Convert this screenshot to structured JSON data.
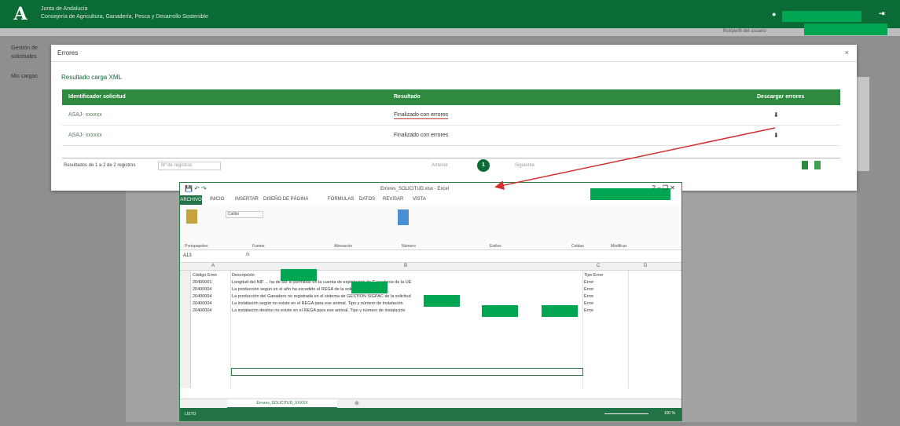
{
  "header": {
    "brand_line1": "Junta de Andalucía",
    "brand_line2": "Consejería de Agricultura, Ganadería, Pesca y Desarrollo Sostenible",
    "logo": "A",
    "user_icon": "user-icon",
    "logout_icon": "logout-icon",
    "logout": "⇥"
  },
  "subheader": {
    "info": "Rol/perfil del usuario"
  },
  "background": {
    "left_item1": "Gestión de solicitudes",
    "left_item2": "Mis cargas"
  },
  "modal": {
    "title": "Errores",
    "close": "×",
    "subtitle": "Resultado carga XML",
    "columns": [
      "Identificador solicitud",
      "Resultado",
      "Descargar errores"
    ],
    "rows": [
      {
        "id": "ASAJ- xxxxxx",
        "result": "Finalizado con errores",
        "download": "⬇"
      },
      {
        "id": "ASAJ- xxxxxx",
        "result": "Finalizado con errores",
        "download": "⬇"
      }
    ],
    "pager": {
      "label": "Resultados de 1 a 2 de 2 registros",
      "select_placeholder": "Nº de registros",
      "prev": "Anterior",
      "page": "1",
      "next": "Siguiente"
    }
  },
  "excel": {
    "filename": "Errores_SOLICITUD.xlsx - Excel",
    "quick_access": "💾 ↶ ↷",
    "window_controls": "?  –  ❐  ✕",
    "tabs": [
      "ARCHIVO",
      "INICIO",
      "INSERTAR",
      "DISEÑO DE PÁGINA",
      "FÓRMULAS",
      "DATOS",
      "REVISAR",
      "VISTA"
    ],
    "ribbon_groups": [
      "Portapapeles",
      "Fuente",
      "Alineación",
      "Número",
      "Estilos",
      "Celdas",
      "Modificar"
    ],
    "font_name": "Calibri",
    "cell_ref": "A13",
    "fx": "fx",
    "columns": [
      "A",
      "B",
      "C",
      "D"
    ],
    "rows": [
      {
        "code": "Código Error",
        "desc": "Descripción",
        "type": "Tipo Error"
      },
      {
        "code": "20400001",
        "desc": "Longitud del NIF ... ha de ser el permitido en la cuenta de explotación de Ganaderos de la UE",
        "type": "Error"
      },
      {
        "code": "20400004",
        "desc": "La producción según en el año ha excedido el REGA de la solicitud",
        "type": "Error"
      },
      {
        "code": "20400004",
        "desc": "La producción del Ganadero no registrada en el sistema de GESTIÓN SIGPAC de la solicitud",
        "type": "Error"
      },
      {
        "code": "20400004",
        "desc": "La instalación según no existe en el REGA para ese animal. Tipo y número de instalación",
        "type": "Error"
      },
      {
        "code": "20400004",
        "desc": "La instalación destino no existe en el REGA para ese animal. Tipo y número de instalación",
        "type": "Error"
      }
    ],
    "sheet_name": "Errores_SOLICITUD_XXXXX",
    "add_sheet": "⊕",
    "status": "LISTO",
    "zoom": "100 %"
  },
  "colors": {
    "header": "#0b6b34",
    "grid_head": "#2d8a3e",
    "excel_green": "#217346",
    "redaction": "#00a651",
    "arrow": "#d32f2f"
  }
}
